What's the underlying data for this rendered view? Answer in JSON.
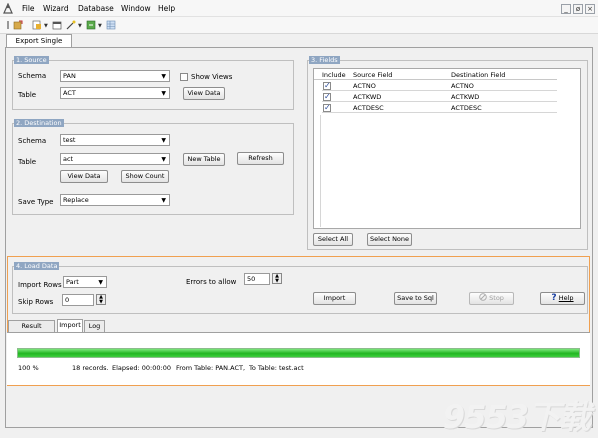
{
  "menu": {
    "file": "File",
    "wizard": "Wizard",
    "database": "Database",
    "window": "Window",
    "help": "Help"
  },
  "window_controls": {
    "minimize": "_",
    "restore": "ø",
    "close": "×"
  },
  "doc_tab": "Export Single Table",
  "source": {
    "title": "1. Source",
    "schema_label": "Schema",
    "schema_value": "PAN",
    "show_views": "Show Views",
    "table_label": "Table",
    "table_value": "ACT",
    "view_data": "View Data"
  },
  "destination": {
    "title": "2. Destination",
    "schema_label": "Schema",
    "schema_value": "test",
    "table_label": "Table",
    "table_value": "act",
    "new_table": "New Table",
    "refresh": "Refresh",
    "view_data": "View Data",
    "show_count": "Show Count",
    "save_type_label": "Save Type",
    "save_type_value": "Replace"
  },
  "fields": {
    "title": "3. Fields",
    "headers": [
      "Include",
      "Source Field",
      "Destination Field"
    ],
    "rows": [
      {
        "include": true,
        "source": "ACTNO",
        "dest": "ACTNO"
      },
      {
        "include": true,
        "source": "ACTKWD",
        "dest": "ACTKWD"
      },
      {
        "include": true,
        "source": "ACTDESC",
        "dest": "ACTDESC"
      }
    ],
    "select_all": "Select All",
    "select_none": "Select None"
  },
  "load": {
    "title": "4. Load Data",
    "import_rows_label": "Import Rows",
    "import_rows_value": "Part",
    "skip_rows_label": "Skip Rows",
    "skip_rows_value": "0",
    "errors_label": "Errors to allow",
    "errors_value": "50",
    "import": "Import",
    "save_to_sql": "Save to Sql",
    "stop": "Stop",
    "help": "Help"
  },
  "result_tabs": [
    "Result Preview",
    "Import",
    "Log"
  ],
  "progress": {
    "value": 1.0
  },
  "status": {
    "percent": "100 %",
    "records": "18 records.",
    "elapsed": "Elapsed: 00:00:00",
    "from": "From Table: PAN.ACT,",
    "to": "To Table: test.act"
  },
  "watermark": "9553下载"
}
